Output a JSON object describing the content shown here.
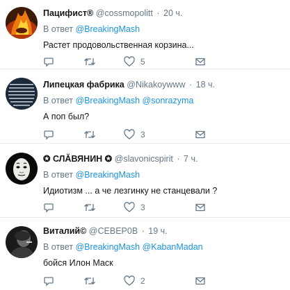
{
  "tweets": [
    {
      "name": "Пацифист®",
      "handle": "@cossmopolitt",
      "time": "20 ч.",
      "reply_prefix": "В ответ",
      "mentions": [
        "@BreakingMash"
      ],
      "text": "Растет продовольственная корзина...",
      "likes": "5",
      "avatar": "fire-avatar"
    },
    {
      "name": "Липецкая фабрика",
      "handle": "@Nikakoywww",
      "time": "18 ч.",
      "reply_prefix": "В ответ",
      "mentions": [
        "@BreakingMash",
        "@sonrazyma"
      ],
      "text": "А поп был?",
      "likes": "3",
      "avatar": "text-quote-avatar"
    },
    {
      "name": "✪ СЛӐВЯНИН ✪",
      "handle": "@slavonicspirit",
      "time": "7 ч.",
      "reply_prefix": "В ответ",
      "mentions": [
        "@BreakingMash"
      ],
      "text": "Идиотизм ... а че лезгинку не станцевали ?",
      "likes": "3",
      "avatar": "mask-avatar"
    },
    {
      "name": "Виталий©",
      "handle": "@СЕВЕР0В",
      "time": "19 ч.",
      "reply_prefix": "В ответ",
      "mentions": [
        "@BreakingMash",
        "@KabanMadan"
      ],
      "text": "бойся Илон Маск",
      "likes": "2",
      "avatar": "dark-portrait-avatar"
    }
  ],
  "colors": {
    "link": "#1b95e0",
    "muted": "#657786",
    "divider": "#e6ecf0",
    "text": "#14171a"
  },
  "icons": [
    "reply-icon",
    "retweet-icon",
    "like-icon",
    "direct-message-icon"
  ]
}
